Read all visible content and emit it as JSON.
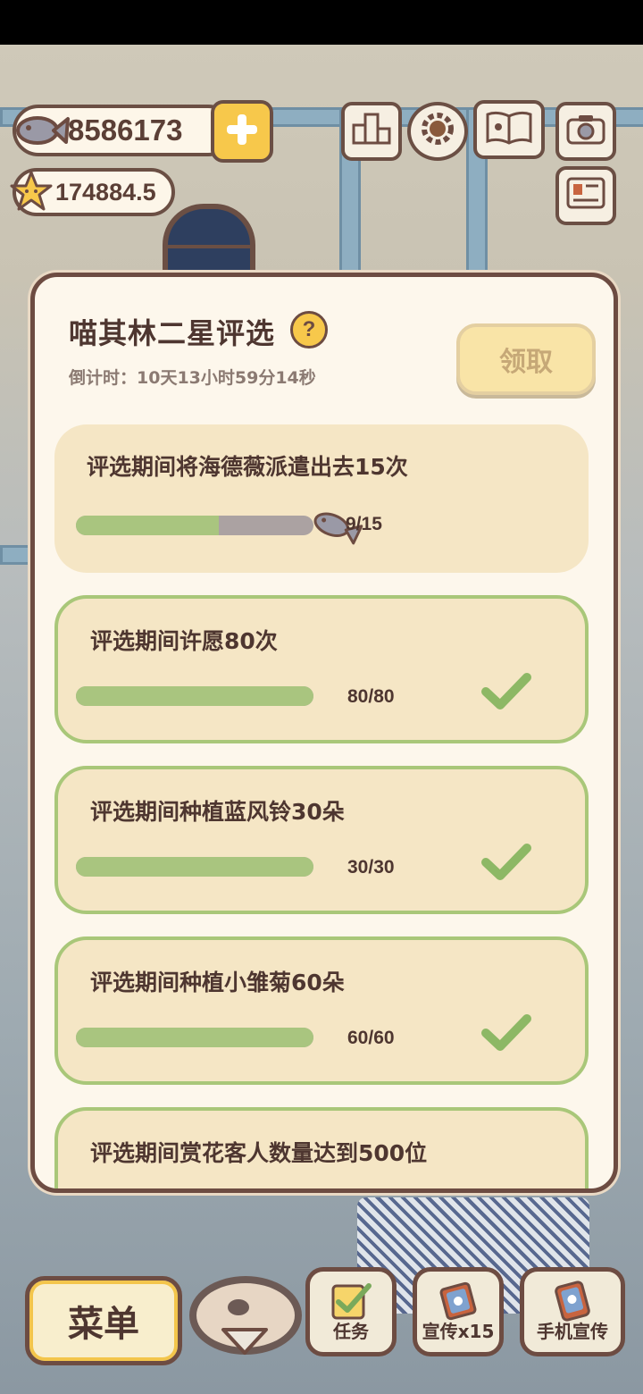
{
  "hud": {
    "fish_count": "8586173",
    "star_count": "174884.5"
  },
  "icons": {
    "fish": "fish-icon",
    "star": "star-icon",
    "plus": "plus-icon",
    "ranking": "ranking-icon",
    "gear": "gear-icon",
    "book": "book-icon",
    "camera": "camera-icon",
    "profile_card": "profile-card-icon"
  },
  "dialog": {
    "title": "喵其林二星评选",
    "help": "?",
    "countdown": "倒计时：10天13小时59分14秒",
    "claim_label": "领取",
    "tasks": [
      {
        "name": "评选期间将海德薇派遣出去15次",
        "progress_text": "9/15",
        "fraction": 0.6,
        "completed": false
      },
      {
        "name": "评选期间许愿80次",
        "progress_text": "80/80",
        "fraction": 1.0,
        "completed": true
      },
      {
        "name": "评选期间种植蓝风铃30朵",
        "progress_text": "30/30",
        "fraction": 1.0,
        "completed": true
      },
      {
        "name": "评选期间种植小雏菊60朵",
        "progress_text": "60/60",
        "fraction": 1.0,
        "completed": true
      },
      {
        "name": "评选期间赏花客人数量达到500位",
        "progress_text": "",
        "fraction": null,
        "completed": null
      }
    ]
  },
  "bottom_bar": {
    "menu_label": "菜单",
    "tasks_label": "任务",
    "promote_label": "宣传x15",
    "phone_promote_label": "手机宣传"
  },
  "colors": {
    "accent_yellow": "#f7c84b",
    "border_brown": "#6d4c42",
    "progress_green": "#a9c57f",
    "panel_bg": "#fdf7ec",
    "task_bg": "#f5e6c5"
  }
}
